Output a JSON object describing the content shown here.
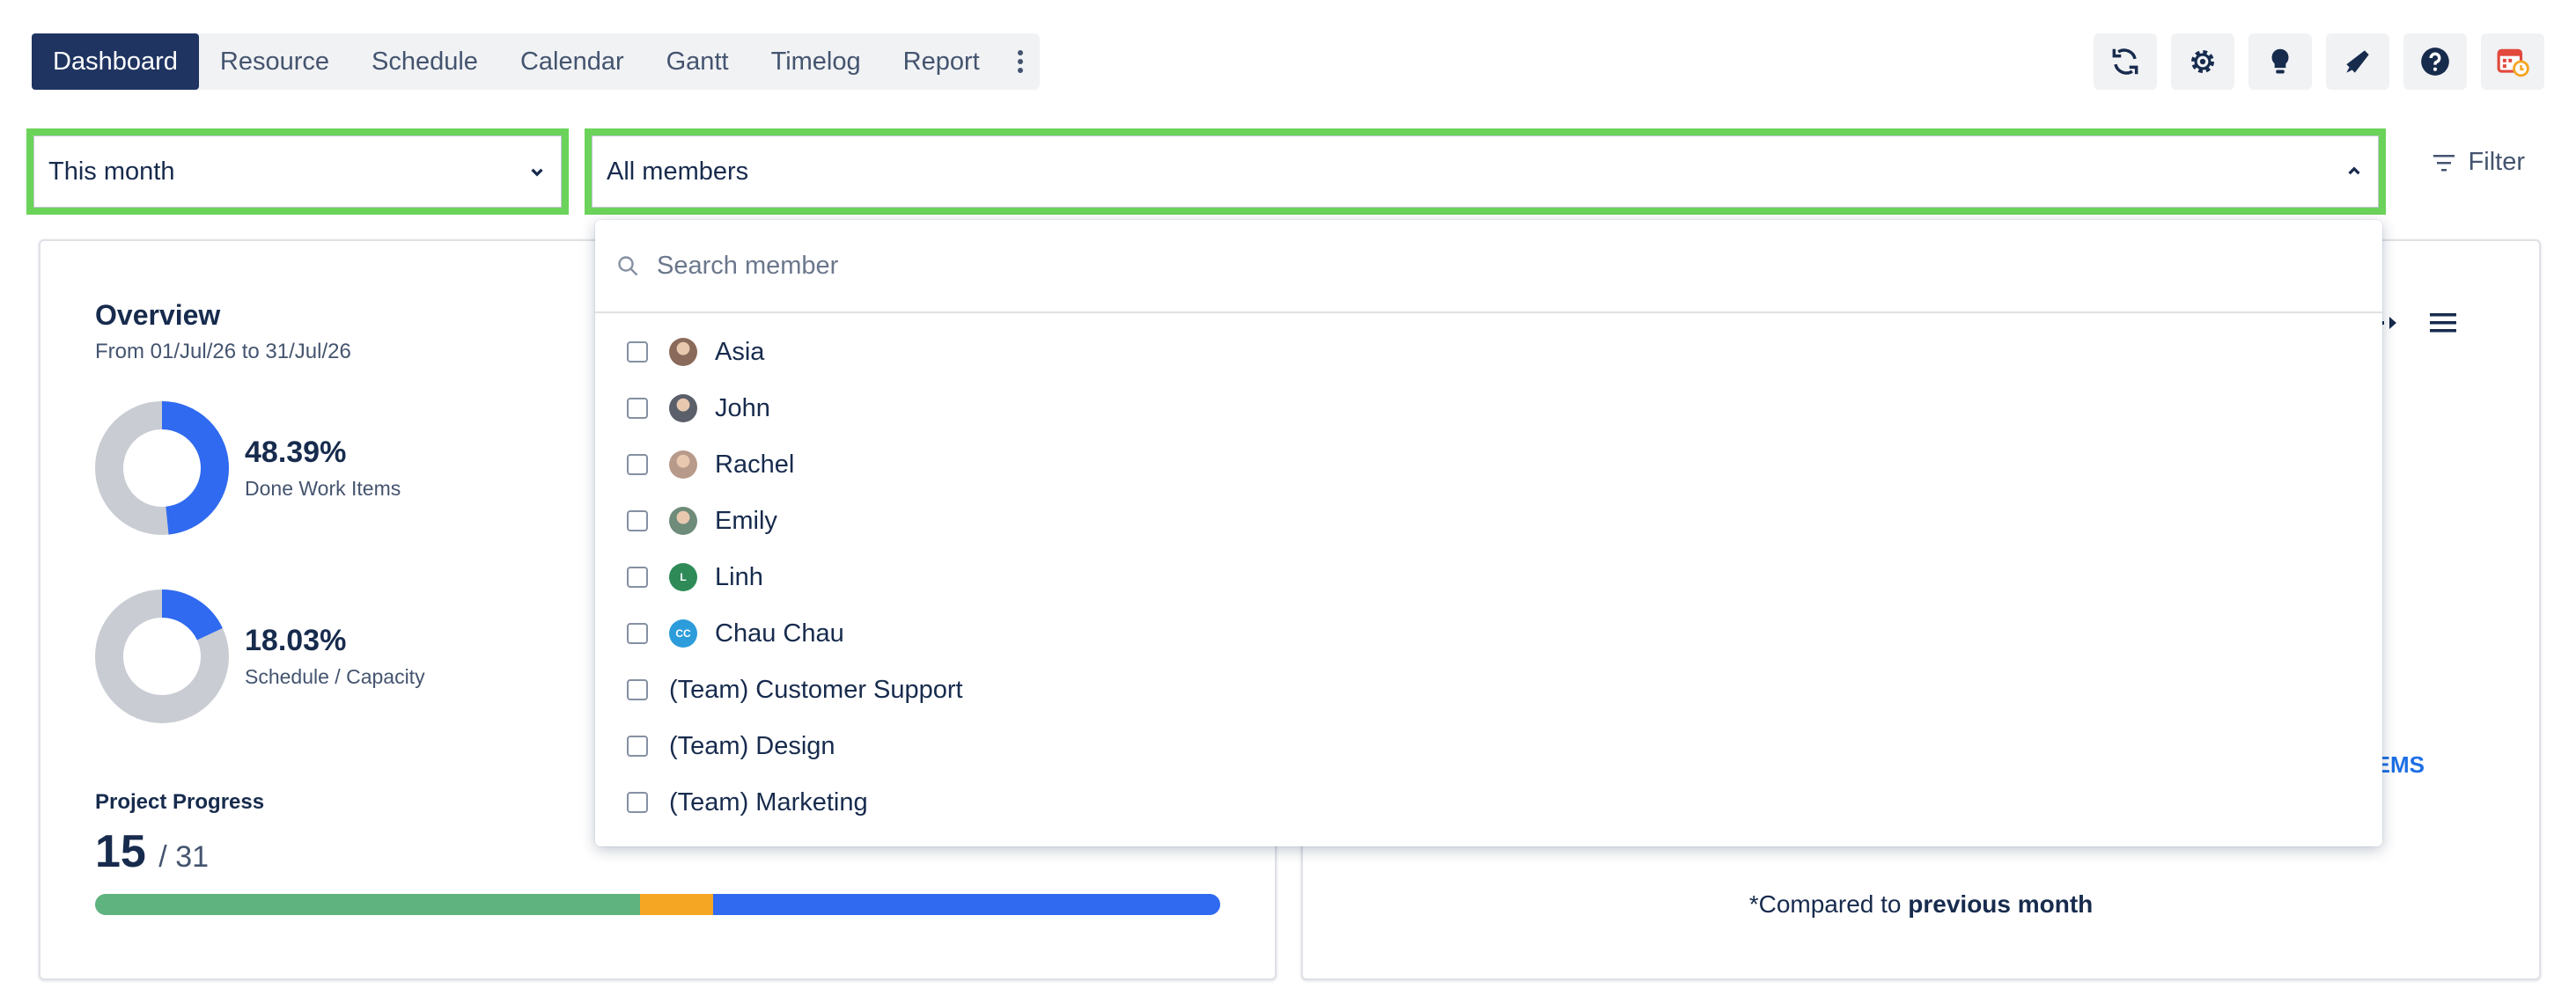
{
  "nav": {
    "tabs": [
      {
        "label": "Dashboard",
        "active": true
      },
      {
        "label": "Resource"
      },
      {
        "label": "Schedule"
      },
      {
        "label": "Calendar"
      },
      {
        "label": "Gantt"
      },
      {
        "label": "Timelog"
      },
      {
        "label": "Report"
      }
    ],
    "more_icon": "vertical-dots-icon"
  },
  "toolbar": {
    "icons": [
      "sync-icon",
      "gear-icon",
      "lightbulb-icon",
      "megaphone-icon",
      "help-icon",
      "calendar-clock-icon"
    ]
  },
  "filters": {
    "period": "This month",
    "members": "All members",
    "filter_label": "Filter"
  },
  "overview": {
    "title": "Overview",
    "range": "From 01/Jul/26 to 31/Jul/26",
    "done": {
      "value": "48.39%",
      "label": "Done Work Items",
      "fraction": 0.4839
    },
    "schedule": {
      "value": "18.03%",
      "label": "Schedule / Capacity",
      "fraction": 0.1803
    },
    "progress": {
      "label": "Project Progress",
      "done": "15",
      "total": "/ 31",
      "segments": [
        {
          "name": "done",
          "fraction": 0.484,
          "color": "#5fb37f"
        },
        {
          "name": "in-progress",
          "fraction": 0.065,
          "color": "#f5a623"
        },
        {
          "name": "to-do",
          "fraction": 0.451,
          "color": "#2f6af0"
        }
      ]
    }
  },
  "right_card": {
    "link_fragment": "EMS",
    "note_prefix": "*Compared to ",
    "note_bold": "previous month"
  },
  "dropdown": {
    "search_placeholder": "Search member",
    "items": [
      {
        "label": "Asia",
        "avatar": "photo"
      },
      {
        "label": "John",
        "avatar": "photo"
      },
      {
        "label": "Rachel",
        "avatar": "photo"
      },
      {
        "label": "Emily",
        "avatar": "photo"
      },
      {
        "label": "Linh",
        "avatar": "initial",
        "initials": "L",
        "color": "#2e8b57"
      },
      {
        "label": "Chau Chau",
        "avatar": "initial",
        "initials": "CC",
        "color": "#2d9cdb"
      },
      {
        "label": "(Team) Customer Support",
        "avatar": "none"
      },
      {
        "label": "(Team) Design",
        "avatar": "none"
      },
      {
        "label": "(Team) Marketing",
        "avatar": "none"
      }
    ]
  },
  "colors": {
    "accent": "#1f3461",
    "highlight": "#6bd35a",
    "blue": "#2f6af0",
    "grey": "#c9ccd3"
  }
}
